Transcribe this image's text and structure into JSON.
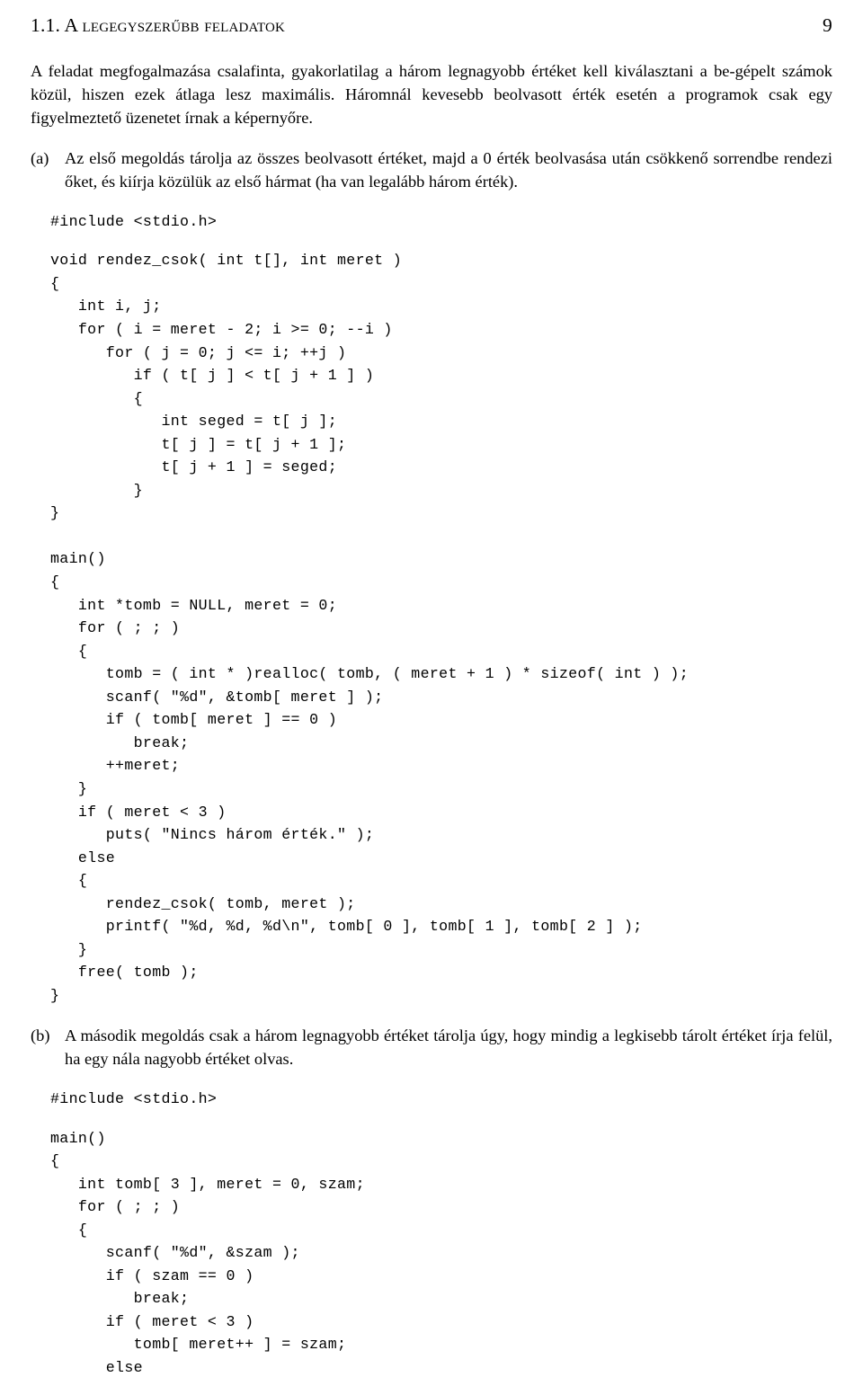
{
  "runhead": {
    "title": "1.1. A legegyszerűbb feladatok",
    "page_number": "9"
  },
  "intro_paragraph": "A feladat megfogalmazása csalafinta, gyakorlatilag a három legnagyobb értéket kell kiválasztani a be-gépelt számok közül, hiszen ezek átlaga lesz maximális. Háromnál kevesebb beolvasott érték esetén a programok csak egy figyelmeztető üzenetet írnak a képernyőre.",
  "items": [
    {
      "marker": "(a)",
      "text": "Az első megoldás tárolja az összes beolvasott értéket, majd a 0 érték beolvasása után csökkenő sorrendbe rendezi őket, és kiírja közülük az első hármat (ha van legalább három érték).",
      "code_header": "#include <stdio.h>",
      "code_body": "void rendez_csok( int t[], int meret )\n{\n   int i, j;\n   for ( i = meret - 2; i >= 0; --i )\n      for ( j = 0; j <= i; ++j )\n         if ( t[ j ] < t[ j + 1 ] )\n         {\n            int seged = t[ j ];\n            t[ j ] = t[ j + 1 ];\n            t[ j + 1 ] = seged;\n         }\n}\n\nmain()\n{\n   int *tomb = NULL, meret = 0;\n   for ( ; ; )\n   {\n      tomb = ( int * )realloc( tomb, ( meret + 1 ) * sizeof( int ) );\n      scanf( \"%d\", &tomb[ meret ] );\n      if ( tomb[ meret ] == 0 )\n         break;\n      ++meret;\n   }\n   if ( meret < 3 )\n      puts( \"Nincs három érték.\" );\n   else\n   {\n      rendez_csok( tomb, meret );\n      printf( \"%d, %d, %d\\n\", tomb[ 0 ], tomb[ 1 ], tomb[ 2 ] );\n   }\n   free( tomb );\n}"
    },
    {
      "marker": "(b)",
      "text": "A második megoldás csak a három legnagyobb értéket tárolja úgy, hogy mindig a legkisebb tárolt értéket írja felül, ha egy nála nagyobb értéket olvas.",
      "code_header": "#include <stdio.h>",
      "code_body": "main()\n{\n   int tomb[ 3 ], meret = 0, szam;\n   for ( ; ; )\n   {\n      scanf( \"%d\", &szam );\n      if ( szam == 0 )\n         break;\n      if ( meret < 3 )\n         tomb[ meret++ ] = szam;\n      else"
    }
  ]
}
